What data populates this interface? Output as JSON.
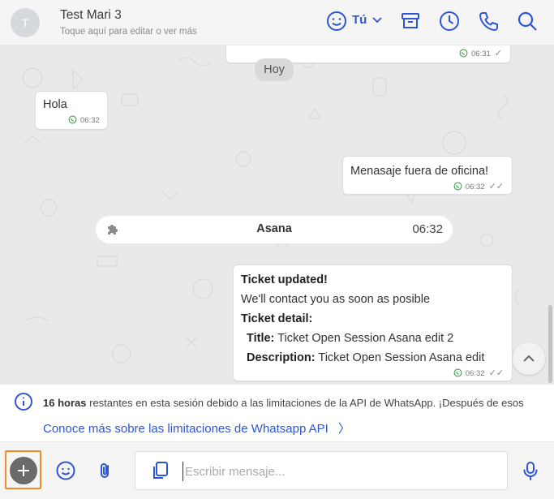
{
  "header": {
    "avatar_initial": "T",
    "contact_name": "Test Mari 3",
    "contact_subtitle": "Toque aquí para editar o ver más",
    "assignee_label": "Tú",
    "accent_color": "#2f55d4"
  },
  "chat": {
    "prev_bubble_time": "06:31",
    "day_divider": "Hoy",
    "messages": [
      {
        "direction": "incoming",
        "text": "Hola",
        "time": "06:32"
      },
      {
        "direction": "outgoing",
        "text": "Menasaje fuera de oficina!",
        "time": "06:32"
      }
    ],
    "event": {
      "icon": "puzzle-icon",
      "title": "Asana",
      "time": "06:32"
    },
    "ticket": {
      "heading": "Ticket updated!",
      "line1": "We'll contact you as soon as posible",
      "detail_heading": "Ticket detail:",
      "title_label": "Title:",
      "title_value": "Ticket Open Session Asana edit 2",
      "description_label": "Description:",
      "description_value": "Ticket Open Session Asana edit",
      "time": "06:32"
    }
  },
  "info": {
    "hours_bold": "16 horas",
    "text": "restantes en esta sesión debido a las limitaciones de la API de WhatsApp. ¡Después de esos",
    "link": "Conoce más sobre las limitaciones de Whatsapp API"
  },
  "composer": {
    "placeholder": "Escribir mensaje...",
    "value": ""
  }
}
